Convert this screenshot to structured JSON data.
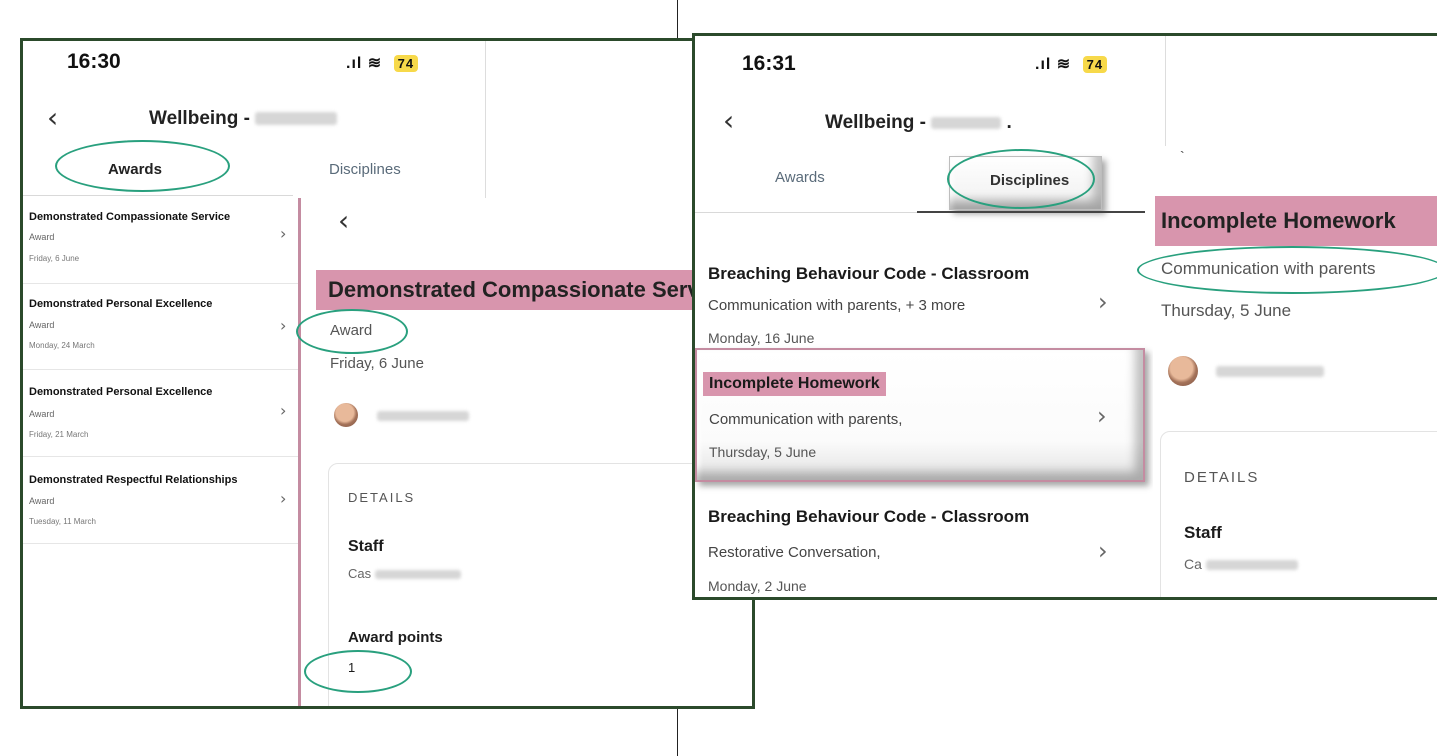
{
  "left": {
    "status": {
      "time": "16:30",
      "signal": ".ıl",
      "wifi": "≋",
      "battery": "74"
    },
    "header": {
      "title": "Wellbeing -"
    },
    "tabs": [
      {
        "label": "Awards"
      },
      {
        "label": "Disciplines"
      }
    ],
    "list": [
      {
        "title": "Demonstrated Compassionate Service",
        "type": "Award",
        "date": "Friday, 6 June"
      },
      {
        "title": "Demonstrated Personal Excellence",
        "type": "Award",
        "date": "Monday, 24 March"
      },
      {
        "title": "Demonstrated Personal Excellence",
        "type": "Award",
        "date": "Friday, 21 March"
      },
      {
        "title": "Demonstrated Respectful Relationships",
        "type": "Award",
        "date": "Tuesday, 11 March"
      }
    ],
    "detail": {
      "title": "Demonstrated Compassionate Serv",
      "type": "Award",
      "date": "Friday, 6 June",
      "details_heading": "DETAILS",
      "staff_label": "Staff",
      "staff_value_prefix": "Cas",
      "points_label": "Award points",
      "points_value": "1"
    }
  },
  "right": {
    "status": {
      "time": "16:31",
      "signal": ".ıl",
      "wifi": "≋",
      "battery": "74"
    },
    "header": {
      "title": "Wellbeing -",
      "suffix": "."
    },
    "tabs": [
      {
        "label": "Awards"
      },
      {
        "label": "Disciplines"
      }
    ],
    "list": [
      {
        "title": "Breaching Behaviour Code - Classroom",
        "sub": "Communication with parents, + 3 more",
        "date": "Monday, 16 June"
      },
      {
        "title": "Incomplete Homework",
        "sub": "Communication with parents,",
        "date": "Thursday, 5 June"
      },
      {
        "title": "Breaching Behaviour Code - Classroom",
        "sub": "Restorative Conversation,",
        "date": "Monday, 2 June"
      }
    ],
    "detail": {
      "title": "Incomplete Homework",
      "sub": "Communication with parents",
      "date": "Thursday, 5 June",
      "details_heading": "DETAILS",
      "staff_label": "Staff",
      "staff_value_prefix": "Ca"
    }
  },
  "icons": {
    "back": "‹",
    "chevron": "›"
  },
  "colors": {
    "frame": "#2b4a2b",
    "highlight": "#d895ad",
    "oval": "#29a07e",
    "battery": "#f7d94a"
  }
}
